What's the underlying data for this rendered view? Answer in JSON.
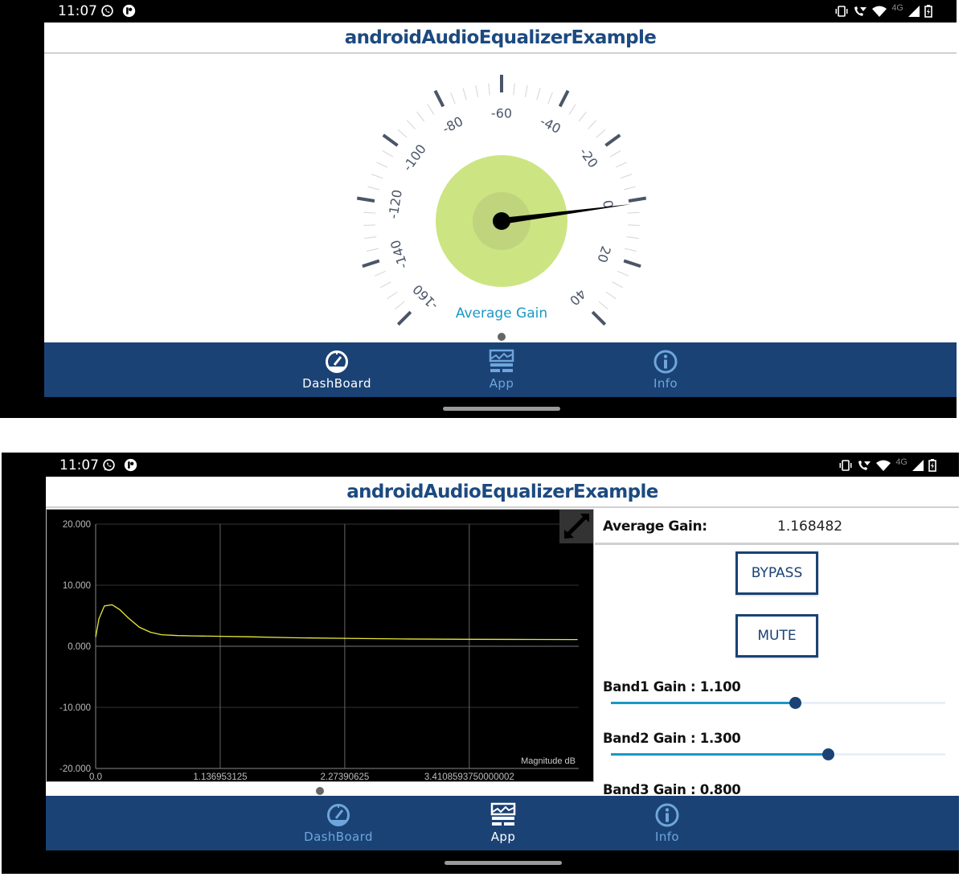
{
  "status_bar": {
    "time": "11:07",
    "left_icons": [
      "whatsapp-icon",
      "app-notification-icon"
    ],
    "right_icons": [
      "vibrate-icon",
      "wifi-calling-icon",
      "wifi-icon",
      "network-4g-icon",
      "signal-icon",
      "battery-charging-icon"
    ],
    "network_label": "4G"
  },
  "app_title": "androidAudioEqualizerExample",
  "nav": {
    "items": [
      {
        "label": "DashBoard",
        "icon": "speedometer-icon"
      },
      {
        "label": "App",
        "icon": "equalizer-chart-icon"
      },
      {
        "label": "Info",
        "icon": "info-icon"
      }
    ]
  },
  "screens": [
    {
      "active_tab": "DashBoard"
    },
    {
      "active_tab": "App"
    }
  ],
  "gauge": {
    "title": "Average Gain",
    "min": -160,
    "max": 40,
    "major_step": 20,
    "minor_divisions": 5,
    "tick_labels": [
      "-160",
      "-140",
      "-120",
      "-100",
      "-80",
      "-60",
      "-40",
      "-20",
      "0",
      "20",
      "40"
    ],
    "value": 1.168482,
    "colors": {
      "outer": "#cde483",
      "inner": "#bfd47c",
      "needle": "#000000",
      "major_tick": "#4a5568",
      "label": "#4a5568",
      "title": "#1b97c7"
    }
  },
  "equalizer": {
    "average_gain_label": "Average Gain:",
    "average_gain_value": "1.168482",
    "bypass_label": "BYPASS",
    "mute_label": "MUTE",
    "bands": [
      {
        "label": "Band1 Gain : 1.100",
        "value": 1.1,
        "fraction": 0.55
      },
      {
        "label": "Band2 Gain : 1.300",
        "value": 1.3,
        "fraction": 0.65
      },
      {
        "label": "Band3 Gain : 0.800",
        "value": 0.8
      }
    ]
  },
  "chart_data": {
    "type": "line",
    "title": "",
    "series": [
      {
        "name": "Magnitude dB",
        "color": "#e8e83a",
        "x": [
          0.0,
          0.03,
          0.08,
          0.15,
          0.22,
          0.3,
          0.4,
          0.5,
          0.6,
          0.75,
          0.9,
          1.1,
          1.4,
          1.8,
          2.27,
          2.8,
          3.4,
          4.0,
          4.4
        ],
        "values": [
          1.5,
          4.5,
          6.6,
          6.8,
          6.0,
          4.6,
          3.1,
          2.3,
          1.9,
          1.75,
          1.7,
          1.65,
          1.55,
          1.4,
          1.3,
          1.2,
          1.15,
          1.12,
          1.1
        ]
      }
    ],
    "legend_label": "Magnitude dB",
    "legend_position": "bottom-right",
    "xlabel": "",
    "ylabel": "",
    "x_ticks": [
      "0.0",
      "1.136953125",
      "2.27390625",
      "3.4108593750000002"
    ],
    "x_tick_values": [
      0.0,
      1.136953125,
      2.27390625,
      3.4108593750000002
    ],
    "y_ticks": [
      "20.000",
      "10.000",
      "0.000",
      "-10.000",
      "-20.000"
    ],
    "y_tick_values": [
      20,
      10,
      0,
      -10,
      -20
    ],
    "xlim": [
      0.0,
      4.41
    ],
    "ylim": [
      -20,
      20
    ],
    "grid": true,
    "background": "#000000"
  }
}
